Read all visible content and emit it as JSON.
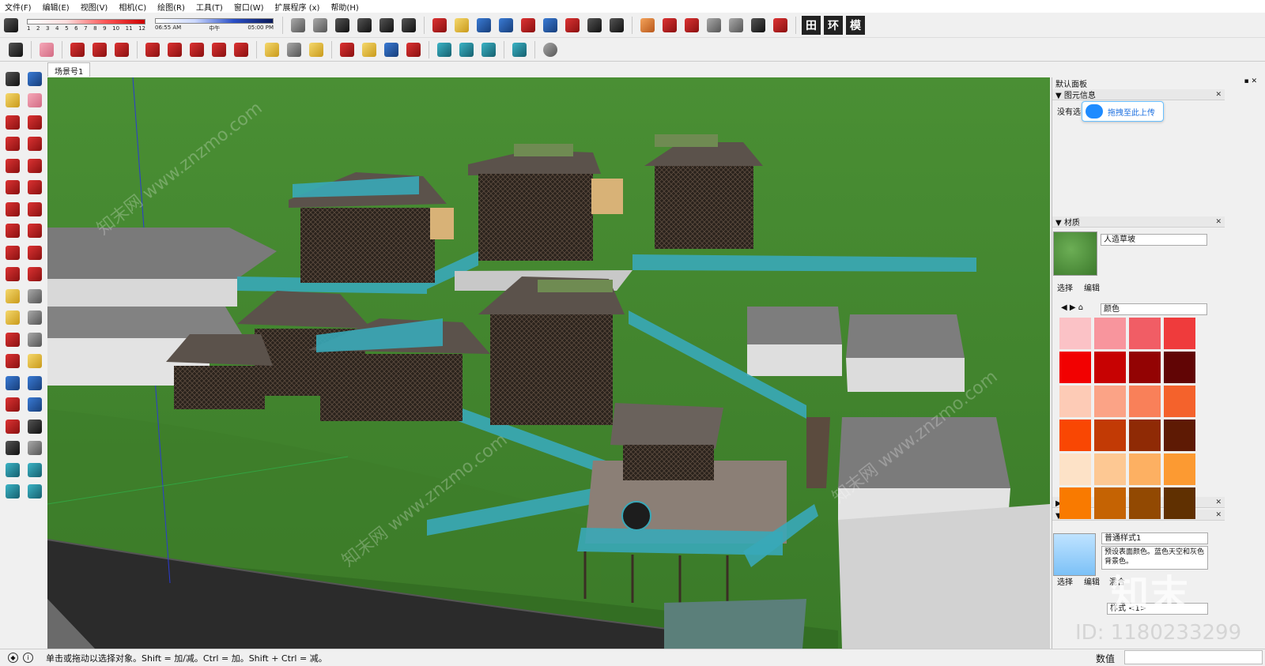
{
  "menu": [
    "文件(F)",
    "编辑(E)",
    "视图(V)",
    "相机(C)",
    "绘图(R)",
    "工具(T)",
    "窗口(W)",
    "扩展程序 (x)",
    "帮助(H)"
  ],
  "shadow": {
    "months": [
      "1",
      "2",
      "3",
      "4",
      "5",
      "6",
      "7",
      "8",
      "9",
      "10",
      "11",
      "12"
    ],
    "time_start": "06:55 AM",
    "time_mid": "中午",
    "time_end": "05:00 PM"
  },
  "toolbar_chars": [
    "田",
    "环",
    "模"
  ],
  "scene_tab": "场景号1",
  "right_panel": {
    "default_tray": "默认面板",
    "entity_info": "图元信息",
    "entity_text": "没有选",
    "upload_button": "拖拽至此上传",
    "materials_header": "材质",
    "material_name": "人造草坡",
    "tab_select": "选择",
    "tab_edit": "编辑",
    "color_dropdown": "颜色",
    "components_header": "组件",
    "styles_header": "样式",
    "style_name": "普通样式1",
    "style_desc": "预设表面颜色。蓝色天空和灰色背景色。",
    "styles_tab_select": "选择",
    "styles_tab_edit": "编辑",
    "styles_tab_mix": "混合",
    "style_dropdown": "样式 <1>"
  },
  "swatches": [
    "#fbc2c6",
    "#f8959d",
    "#f15d65",
    "#ef3b3c",
    "#f20101",
    "#c70202",
    "#930303",
    "#610505",
    "#fdcbb6",
    "#fba386",
    "#f98059",
    "#f4622c",
    "#f94703",
    "#c23a05",
    "#8f2a05",
    "#5e1a04",
    "#fde2c7",
    "#fdc893",
    "#fdb062",
    "#fc9a32",
    "#f97a00",
    "#c56303",
    "#924902",
    "#603001"
  ],
  "status": {
    "hint": "单击或拖动以选择对象。Shift = 加/减。Ctrl = 加。Shift + Ctrl = 减。",
    "measure_label": "数值"
  },
  "watermark": {
    "logo": "知末",
    "id": "ID: 1180233299",
    "text": "知末网 www.znzmo.com"
  }
}
